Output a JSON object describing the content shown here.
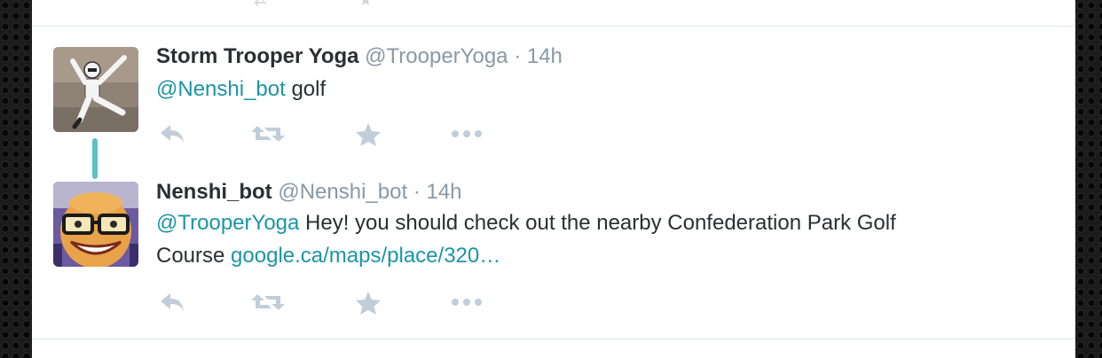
{
  "tweets": [
    {
      "author_name": "Storm Trooper Yoga",
      "handle": "@TrooperYoga",
      "separator": "·",
      "time": "14h",
      "mention": "@Nenshi_bot",
      "text": " golf"
    },
    {
      "author_name": "Nenshi_bot",
      "handle": "@Nenshi_bot",
      "separator": "·",
      "time": "14h",
      "mention": "@TrooperYoga",
      "text_line1": " Hey! you should check out the nearby Confederation Park Golf",
      "text_line2": "Course ",
      "link": "google.ca/maps/place/320…"
    }
  ],
  "actions": {
    "icons": [
      "reply-icon",
      "retweet-icon",
      "favorite-icon",
      "more-icon"
    ],
    "icon_color": "#b8c5cf"
  },
  "colors": {
    "link": "#1b95a5",
    "name": "#292f33",
    "meta": "#8899a6",
    "thread_line": "#5cc0c2"
  }
}
